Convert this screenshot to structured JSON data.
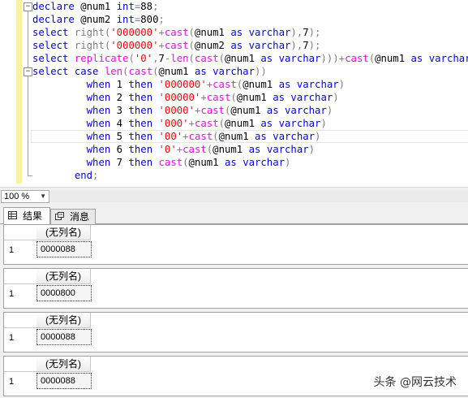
{
  "editor": {
    "lines": [
      [
        [
          "kw",
          "declare "
        ],
        [
          "pl",
          "@num1 "
        ],
        [
          "kw",
          "int"
        ],
        [
          "gr",
          "="
        ],
        [
          "pl",
          "88"
        ],
        [
          "gr",
          ";"
        ]
      ],
      [
        [
          "kw",
          "declare "
        ],
        [
          "pl",
          "@num2 "
        ],
        [
          "kw",
          "int"
        ],
        [
          "gr",
          "="
        ],
        [
          "pl",
          "800"
        ],
        [
          "gr",
          ";"
        ]
      ],
      [
        [
          "kw",
          "select "
        ],
        [
          "gr",
          "right("
        ],
        [
          "str",
          "'000000'"
        ],
        [
          "gr",
          "+"
        ],
        [
          "fn",
          "cast"
        ],
        [
          "gr",
          "("
        ],
        [
          "pl",
          "@num1 "
        ],
        [
          "kw",
          "as "
        ],
        [
          "kw",
          "varchar"
        ],
        [
          "gr",
          "),"
        ],
        [
          "pl",
          "7"
        ],
        [
          "gr",
          ");"
        ]
      ],
      [
        [
          "kw",
          "select "
        ],
        [
          "gr",
          "right("
        ],
        [
          "str",
          "'000000'"
        ],
        [
          "gr",
          "+"
        ],
        [
          "fn",
          "cast"
        ],
        [
          "gr",
          "("
        ],
        [
          "pl",
          "@num2 "
        ],
        [
          "kw",
          "as "
        ],
        [
          "kw",
          "varchar"
        ],
        [
          "gr",
          "),"
        ],
        [
          "pl",
          "7"
        ],
        [
          "gr",
          ");"
        ]
      ],
      [
        [
          "kw",
          "select "
        ],
        [
          "fn",
          "replicate"
        ],
        [
          "gr",
          "("
        ],
        [
          "str",
          "'0'"
        ],
        [
          "gr",
          ","
        ],
        [
          "pl",
          "7"
        ],
        [
          "gr",
          "-"
        ],
        [
          "fn",
          "len"
        ],
        [
          "gr",
          "("
        ],
        [
          "fn",
          "cast"
        ],
        [
          "gr",
          "("
        ],
        [
          "pl",
          "@num1 "
        ],
        [
          "kw",
          "as "
        ],
        [
          "kw",
          "varchar"
        ],
        [
          "gr",
          ")))+"
        ],
        [
          "fn",
          "cast"
        ],
        [
          "gr",
          "("
        ],
        [
          "pl",
          "@num1 "
        ],
        [
          "kw",
          "as "
        ],
        [
          "kw",
          "varchar"
        ],
        [
          "gr",
          ");"
        ]
      ],
      [
        [
          "kw",
          "select "
        ],
        [
          "kw",
          "case "
        ],
        [
          "fn",
          "len"
        ],
        [
          "gr",
          "("
        ],
        [
          "fn",
          "cast"
        ],
        [
          "gr",
          "("
        ],
        [
          "pl",
          "@num1 "
        ],
        [
          "kw",
          "as "
        ],
        [
          "kw",
          "varchar"
        ],
        [
          "gr",
          "))"
        ]
      ],
      [
        [
          "pl",
          "         "
        ],
        [
          "kw",
          "when "
        ],
        [
          "pl",
          "1 "
        ],
        [
          "kw",
          "then "
        ],
        [
          "str",
          "'000000'"
        ],
        [
          "gr",
          "+"
        ],
        [
          "fn",
          "cast"
        ],
        [
          "gr",
          "("
        ],
        [
          "pl",
          "@num1 "
        ],
        [
          "kw",
          "as "
        ],
        [
          "kw",
          "varchar"
        ],
        [
          "gr",
          ")"
        ]
      ],
      [
        [
          "pl",
          "         "
        ],
        [
          "kw",
          "when "
        ],
        [
          "pl",
          "2 "
        ],
        [
          "kw",
          "then "
        ],
        [
          "str",
          "'00000'"
        ],
        [
          "gr",
          "+"
        ],
        [
          "fn",
          "cast"
        ],
        [
          "gr",
          "("
        ],
        [
          "pl",
          "@num1 "
        ],
        [
          "kw",
          "as "
        ],
        [
          "kw",
          "varchar"
        ],
        [
          "gr",
          ")"
        ]
      ],
      [
        [
          "pl",
          "         "
        ],
        [
          "kw",
          "when "
        ],
        [
          "pl",
          "3 "
        ],
        [
          "kw",
          "then "
        ],
        [
          "str",
          "'0000'"
        ],
        [
          "gr",
          "+"
        ],
        [
          "fn",
          "cast"
        ],
        [
          "gr",
          "("
        ],
        [
          "pl",
          "@num1 "
        ],
        [
          "kw",
          "as "
        ],
        [
          "kw",
          "varchar"
        ],
        [
          "gr",
          ")"
        ]
      ],
      [
        [
          "pl",
          "         "
        ],
        [
          "kw",
          "when "
        ],
        [
          "pl",
          "4 "
        ],
        [
          "kw",
          "then "
        ],
        [
          "str",
          "'000'"
        ],
        [
          "gr",
          "+"
        ],
        [
          "fn",
          "cast"
        ],
        [
          "gr",
          "("
        ],
        [
          "pl",
          "@num1 "
        ],
        [
          "kw",
          "as "
        ],
        [
          "kw",
          "varchar"
        ],
        [
          "gr",
          ")"
        ]
      ],
      [
        [
          "pl",
          "         "
        ],
        [
          "kw",
          "when "
        ],
        [
          "pl",
          "5 "
        ],
        [
          "kw",
          "then "
        ],
        [
          "str",
          "'00'"
        ],
        [
          "gr",
          "+"
        ],
        [
          "fn",
          "cast"
        ],
        [
          "gr",
          "("
        ],
        [
          "pl",
          "@num1 "
        ],
        [
          "kw",
          "as "
        ],
        [
          "kw",
          "varchar"
        ],
        [
          "gr",
          ")"
        ]
      ],
      [
        [
          "pl",
          "         "
        ],
        [
          "kw",
          "when "
        ],
        [
          "pl",
          "6 "
        ],
        [
          "kw",
          "then "
        ],
        [
          "str",
          "'0'"
        ],
        [
          "gr",
          "+"
        ],
        [
          "fn",
          "cast"
        ],
        [
          "gr",
          "("
        ],
        [
          "pl",
          "@num1 "
        ],
        [
          "kw",
          "as "
        ],
        [
          "kw",
          "varchar"
        ],
        [
          "gr",
          ")"
        ]
      ],
      [
        [
          "pl",
          "         "
        ],
        [
          "kw",
          "when "
        ],
        [
          "pl",
          "7 "
        ],
        [
          "kw",
          "then "
        ],
        [
          "fn",
          "cast"
        ],
        [
          "gr",
          "("
        ],
        [
          "pl",
          "@num1 "
        ],
        [
          "kw",
          "as "
        ],
        [
          "kw",
          "varchar"
        ],
        [
          "gr",
          ")"
        ]
      ],
      [
        [
          "pl",
          "       "
        ],
        [
          "kw",
          "end"
        ],
        [
          "gr",
          ";"
        ]
      ]
    ],
    "collapse_symbol": "−"
  },
  "zoom": {
    "value": "100 %",
    "arrow": "▼"
  },
  "tabs": [
    {
      "label": "结果",
      "icon": "grid-icon"
    },
    {
      "label": "消息",
      "icon": "messages-icon"
    }
  ],
  "results": [
    {
      "header": "(无列名)",
      "row": "1",
      "value": "0000088"
    },
    {
      "header": "(无列名)",
      "row": "1",
      "value": "0000800"
    },
    {
      "header": "(无列名)",
      "row": "1",
      "value": "0000088"
    },
    {
      "header": "(无列名)",
      "row": "1",
      "value": "0000088"
    }
  ],
  "watermark": "头条 @网云技术"
}
